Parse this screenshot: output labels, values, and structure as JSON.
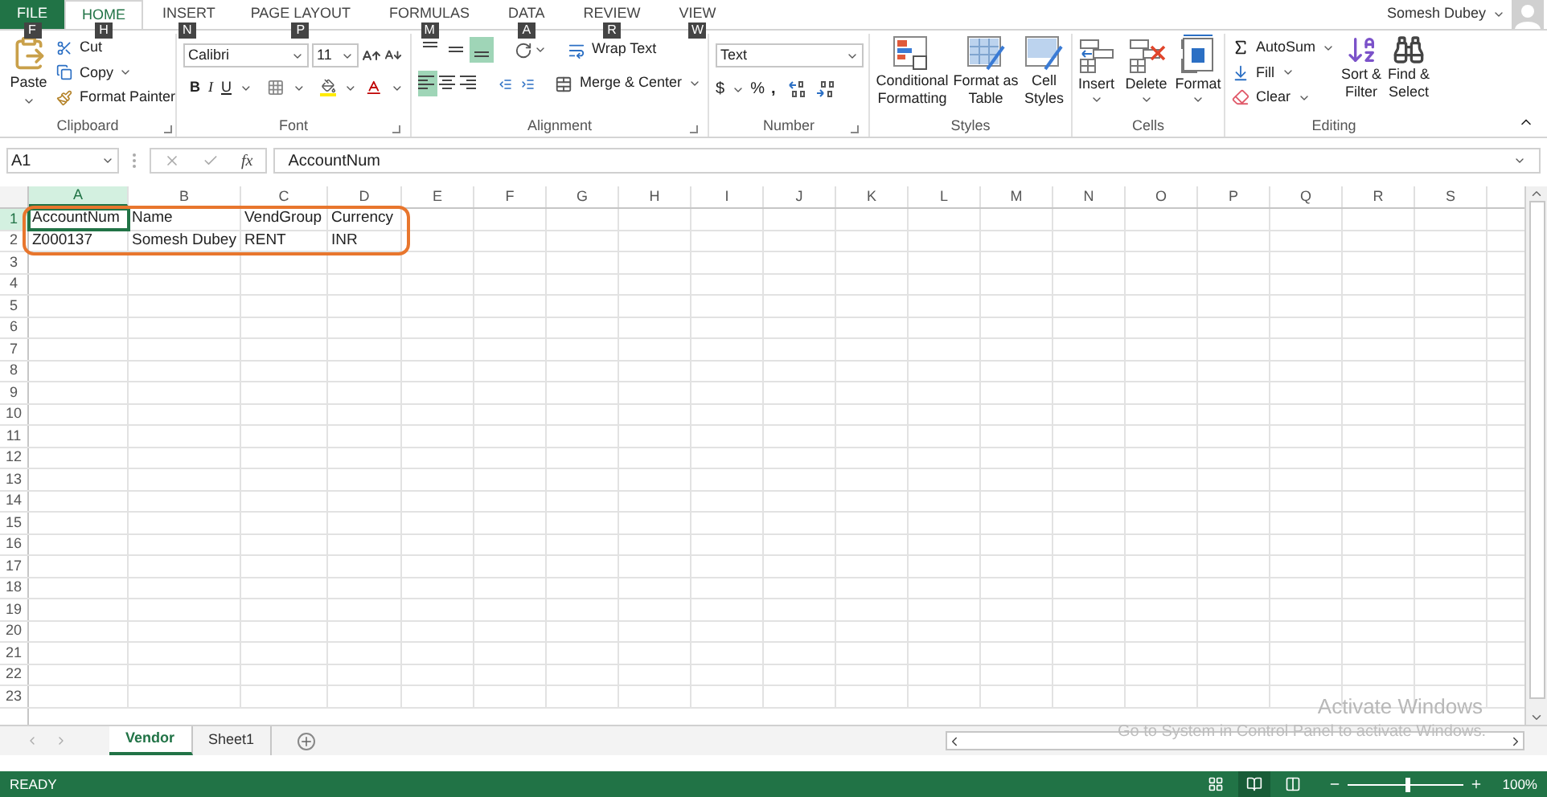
{
  "tabs": [
    {
      "label": "FILE",
      "kind": "file",
      "key_tip": "F",
      "selected": false
    },
    {
      "label": "HOME",
      "kind": "tab",
      "key_tip": "H",
      "selected": true
    },
    {
      "label": "INSERT",
      "kind": "tab",
      "key_tip": "N",
      "selected": false
    },
    {
      "label": "PAGE LAYOUT",
      "kind": "tab",
      "key_tip": "P",
      "selected": false
    },
    {
      "label": "FORMULAS",
      "kind": "tab",
      "key_tip": "M",
      "selected": false
    },
    {
      "label": "DATA",
      "kind": "tab",
      "key_tip": "A",
      "selected": false
    },
    {
      "label": "REVIEW",
      "kind": "tab",
      "key_tip": "R",
      "selected": false
    },
    {
      "label": "VIEW",
      "kind": "tab",
      "key_tip": "W",
      "selected": false
    }
  ],
  "user": {
    "name": "Somesh Dubey"
  },
  "clipboard": {
    "title": "Clipboard",
    "paste": "Paste",
    "cut": "Cut",
    "copy": "Copy",
    "format_painter": "Format Painter"
  },
  "font": {
    "title": "Font",
    "font_name": "Calibri",
    "font_size": "11",
    "bold": "B",
    "italic": "I",
    "underline": "U"
  },
  "alignment": {
    "title": "Alignment",
    "wrap_text": "Wrap Text",
    "merge_center": "Merge & Center",
    "vertical": [
      {
        "selected": false
      },
      {
        "selected": false
      },
      {
        "selected": true
      }
    ],
    "horizontal": [
      {
        "selected": true
      },
      {
        "selected": false
      },
      {
        "selected": false
      }
    ]
  },
  "number": {
    "title": "Number",
    "format": "Text",
    "currency": "$",
    "percent": "%",
    "comma": ","
  },
  "styles": {
    "title": "Styles",
    "buttons": [
      {
        "kind": "conditional",
        "lines": [
          "Conditional",
          "Formatting"
        ]
      },
      {
        "kind": "table",
        "lines": [
          "Format as",
          "Table"
        ]
      },
      {
        "kind": "cell",
        "lines": [
          "Cell",
          "Styles"
        ]
      }
    ]
  },
  "cells": {
    "title": "Cells",
    "buttons": [
      {
        "kind": "insert",
        "label": "Insert"
      },
      {
        "kind": "delete",
        "label": "Delete"
      },
      {
        "kind": "format",
        "label": "Format"
      }
    ]
  },
  "editing": {
    "title": "Editing",
    "autosum": "AutoSum",
    "fill": "Fill",
    "clear": "Clear",
    "sort": [
      "Sort &",
      "Filter"
    ],
    "find": [
      "Find &",
      "Select"
    ]
  },
  "formula_bar": {
    "name_box": "A1",
    "fx": "fx",
    "value": "AccountNum"
  },
  "columns": [
    "A",
    "B",
    "C",
    "D",
    "E",
    "F",
    "G",
    "H",
    "I",
    "J",
    "K",
    "L",
    "M",
    "N",
    "O",
    "P",
    "Q",
    "R",
    "S"
  ],
  "rows": [
    {
      "label": "1",
      "cells": [
        {
          "text": "AccountNum",
          "selected": true
        },
        {
          "text": "Name",
          "selected": false
        },
        {
          "text": "VendGroup",
          "selected": false
        },
        {
          "text": "Currency",
          "selected": false
        }
      ]
    },
    {
      "label": "2",
      "cells": [
        {
          "text": "Z000137",
          "selected": false
        },
        {
          "text": "Somesh Dubey",
          "selected": false
        },
        {
          "text": "RENT",
          "selected": false
        },
        {
          "text": "INR",
          "selected": false
        }
      ]
    },
    {
      "label": "3"
    },
    {
      "label": "4"
    },
    {
      "label": "5"
    },
    {
      "label": "6"
    },
    {
      "label": "7"
    },
    {
      "label": "8"
    },
    {
      "label": "9"
    },
    {
      "label": "10"
    },
    {
      "label": "11"
    },
    {
      "label": "12"
    },
    {
      "label": "13"
    },
    {
      "label": "14"
    },
    {
      "label": "15"
    },
    {
      "label": "16"
    },
    {
      "label": "17"
    },
    {
      "label": "18"
    },
    {
      "label": "19"
    },
    {
      "label": "20"
    },
    {
      "label": "21"
    },
    {
      "label": "22"
    },
    {
      "label": "23"
    }
  ],
  "sheet_tabs": [
    {
      "label": "Vendor",
      "selected": true
    },
    {
      "label": "Sheet1",
      "selected": false
    }
  ],
  "activation_notice": {
    "title": "Activate Windows",
    "subtitle": "Go to System in Control Panel to activate Windows."
  },
  "status_bar": {
    "mode": "READY",
    "views": [
      {
        "kind": "normal",
        "selected": false
      },
      {
        "kind": "page_layout",
        "selected": true
      },
      {
        "kind": "page_break",
        "selected": false
      }
    ],
    "zoom": {
      "level": 0.49,
      "reading": "100%"
    }
  }
}
